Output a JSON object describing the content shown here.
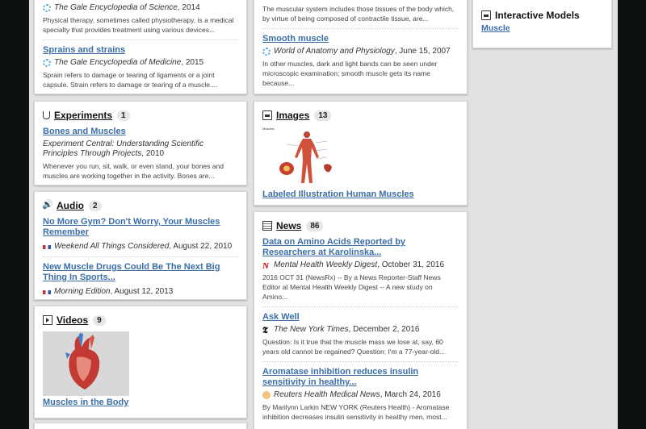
{
  "col1": {
    "top_card": {
      "items": [
        {
          "source_name": "The Gale Encyclopedia of Science",
          "source_date": ", 2014",
          "snippet": "Physical therapy, sometimes called physiotherapy, is a medical specialty that provides treatment using various devices..."
        },
        {
          "title": "Sprains and strains",
          "source_name": "The Gale Encyclopedia of Medicine",
          "source_date": ", 2015",
          "snippet": "Sprain refers to damage or tearing of ligaments or a joint capsule. Strain refers to damage or tearing of a muscle...."
        }
      ]
    },
    "experiments": {
      "title": "Experiments",
      "count": "1",
      "items": [
        {
          "title": "Bones and Muscles",
          "source_name": "Experiment Central: Understanding Scientific Principles Through Projects",
          "source_date": ", 2010",
          "snippet": "Whenever you run, sit, walk, or even stand, your bones and muscles are working together in the activity. Bones are..."
        }
      ]
    },
    "audio": {
      "title": "Audio",
      "count": "2",
      "items": [
        {
          "title": "No More Gym? Don't Worry, Your Muscles Remember",
          "source_name": "Weekend All Things Considered",
          "source_date": ", August 22, 2010"
        },
        {
          "title": "New Muscle Drugs Could Be The Next Big Thing In Sports...",
          "source_name": "Morning Edition",
          "source_date": ", August 12, 2013"
        }
      ]
    },
    "videos": {
      "title": "Videos",
      "count": "9",
      "items": [
        {
          "title": "Muscles in the Body"
        }
      ]
    }
  },
  "col2": {
    "top_card": {
      "snippet_top": "The muscular system includes those tissues of the body which, by virtue of being composed of contractile tissue, are...",
      "items": [
        {
          "title": "Smooth muscle",
          "source_name": "World of Anatomy and Physiology",
          "source_date": ", June 15, 2007",
          "snippet": "In other muscles, dark and light bands can be seen under microscopic examination; smooth muscle gets its name because..."
        }
      ]
    },
    "images": {
      "title": "Images",
      "count": "13",
      "image_caption": "Muscles",
      "items": [
        {
          "title": "Labeled Illustration Human Muscles"
        }
      ]
    },
    "news": {
      "title": "News",
      "count": "86",
      "items": [
        {
          "title": "Data on Amino Acids Reported by Researchers at Karolinska...",
          "source_name": "Mental Health Weekly Digest",
          "source_date": ", October 31, 2016",
          "source_icon": "N",
          "snippet": "2016 OCT 31 (NewsRx) -- By a News Reporter-Staff News Editor at Mental Health Weekly Digest -- A new study on Amino..."
        },
        {
          "title": "Ask Well",
          "source_name": "The New York Times",
          "source_date": ", December 2, 2016",
          "source_icon": "𝕿",
          "snippet": "Question: Is it true that the muscle mass we lose at, say, 60 years old cannot be regained? Question: I'm a 77-year-old..."
        },
        {
          "title": "Aromatase inhibition reduces insulin sensitivity in healthy...",
          "source_name": "Reuters Health Medical News",
          "source_date": ", March 24, 2016",
          "snippet": "By Marilynn Larkin NEW YORK (Reuters Health) - Aromatase inhibition decreases insulin sensitivity in healthy men, most..."
        }
      ]
    }
  },
  "col3": {
    "models": {
      "title": "Interactive Models",
      "items": [
        {
          "title": "Muscle"
        }
      ]
    }
  }
}
